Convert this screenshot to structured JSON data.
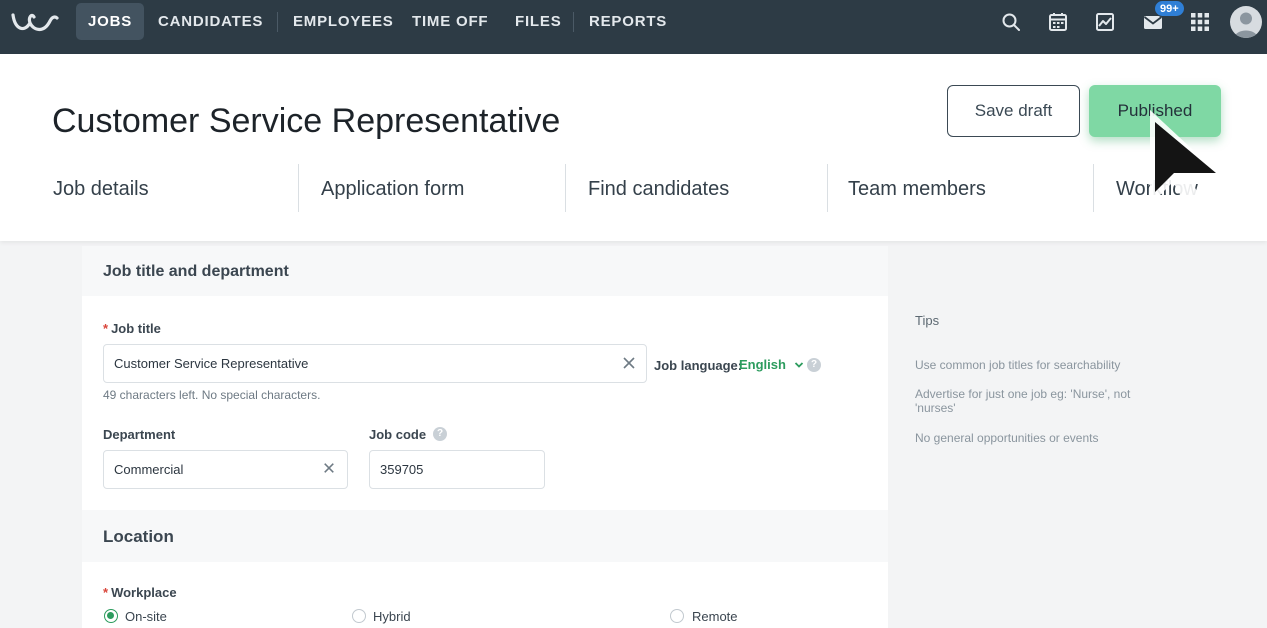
{
  "nav": {
    "items": [
      "JOBS",
      "CANDIDATES",
      "EMPLOYEES",
      "TIME OFF",
      "FILES",
      "REPORTS"
    ],
    "active": "JOBS",
    "icons": [
      "search-icon",
      "calendar-icon",
      "chart-icon",
      "mail-icon",
      "apps-grid-icon"
    ],
    "mail_badge": "99+"
  },
  "header": {
    "title": "Customer Service Representative",
    "save_draft": "Save draft",
    "published": "Published",
    "tabs": [
      "Job details",
      "Application form",
      "Find candidates",
      "Team members",
      "Workflow"
    ]
  },
  "form": {
    "section_job": "Job title and department",
    "job_title_label": "Job title",
    "job_title_value": "Customer Service Representative",
    "job_title_hint": "49 characters left. No special characters.",
    "job_language_label": "Job language:",
    "job_language_value": "English",
    "department_label": "Department",
    "department_value": "Commercial",
    "job_code_label": "Job code",
    "job_code_value": "359705",
    "section_location": "Location",
    "workplace_label": "Workplace",
    "workplace_options": [
      "On-site",
      "Hybrid",
      "Remote"
    ],
    "workplace_selected": "On-site"
  },
  "tips": {
    "title": "Tips",
    "items": [
      "Use common job titles for searchability",
      "Advertise for just one job eg: 'Nurse', not 'nurses'",
      "No general opportunities or events"
    ]
  },
  "colors": {
    "nav_bg": "#2d3b45",
    "published_bg": "#7fd8a4",
    "accent_green": "#2c9c5e",
    "badge_blue": "#2f7fd6"
  }
}
